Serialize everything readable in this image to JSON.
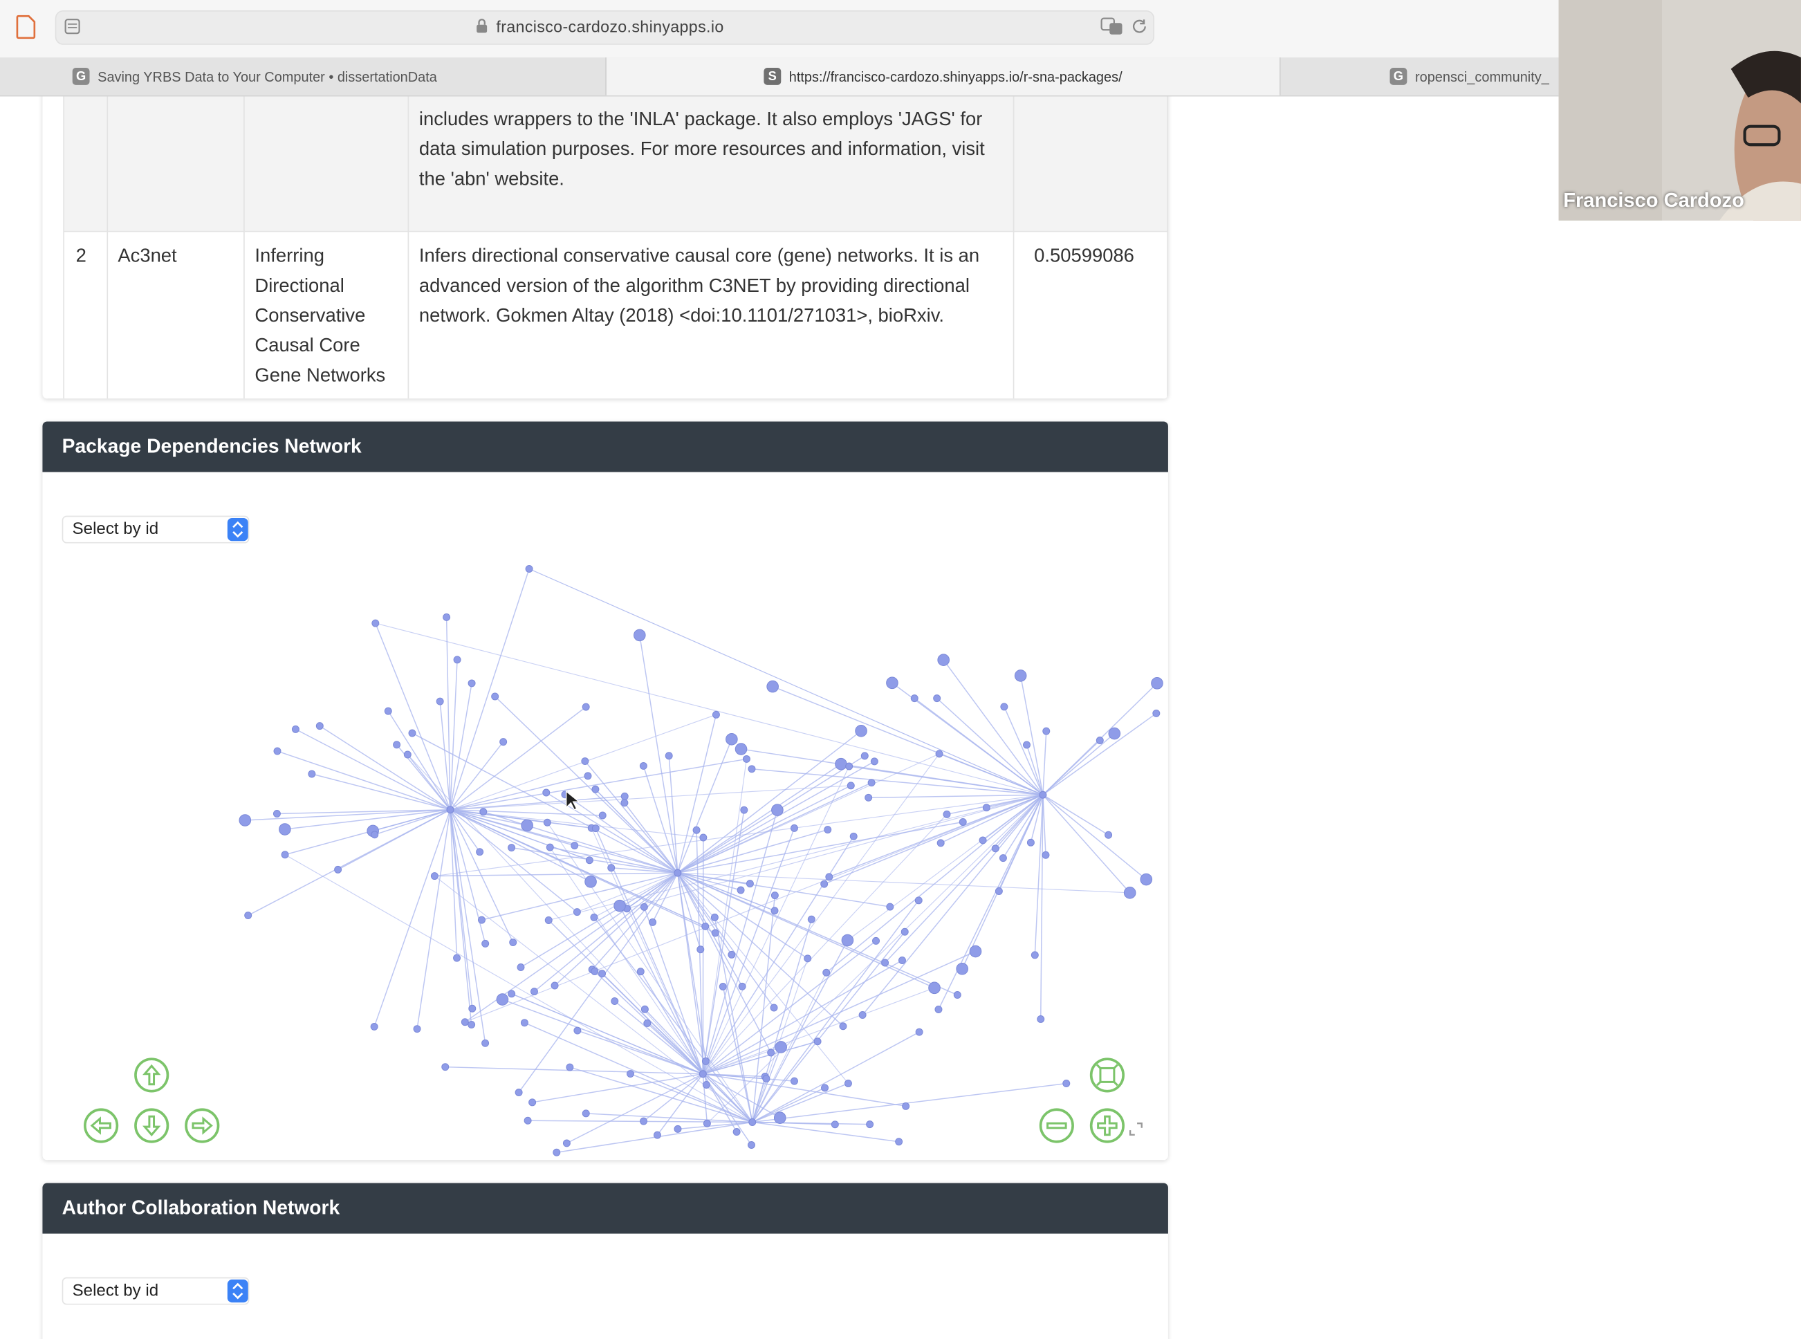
{
  "browser": {
    "url": "francisco-cardozo.shinyapps.io",
    "tabs": [
      {
        "favicon": "G",
        "title": "Saving YRBS Data to Your Computer • dissertationData"
      },
      {
        "favicon": "S",
        "title": "https://francisco-cardozo.shinyapps.io/r-sna-packages/",
        "active": true
      },
      {
        "favicon": "G",
        "title": "ropensci_community_"
      }
    ]
  },
  "table": {
    "rows": [
      {
        "index": "",
        "name": "",
        "title": "",
        "description": "includes wrappers to the 'INLA' package. It also employs 'JAGS' for data simulation purposes. For more resources and information, visit the 'abn' website.",
        "value": ""
      },
      {
        "index": "2",
        "name": "Ac3net",
        "title": "Inferring Directional Conservative Causal Core Gene Networks",
        "description": "Infers directional conservative causal core (gene) networks. It is an advanced version of the algorithm C3NET by providing directional network. Gokmen Altay (2018) <doi:10.1101/271031>, bioRxiv.",
        "value": "0.50599086"
      }
    ]
  },
  "panels": {
    "dependencies": {
      "title": "Package Dependencies Network",
      "select_label": "Select by id"
    },
    "collaboration": {
      "title": "Author Collaboration Network",
      "select_label": "Select by id"
    }
  },
  "graph": {
    "node_color": "#8f9ce8",
    "edge_color": "#a7b4ee",
    "nav_button_color": "#7cc46a",
    "nav_buttons": [
      "up-arrow-icon",
      "left-arrow-icon",
      "down-arrow-icon",
      "right-arrow-icon",
      "zoom-out-icon",
      "zoom-in-icon",
      "fit-icon"
    ]
  },
  "video": {
    "participant_name": "Francisco Cardozo"
  }
}
